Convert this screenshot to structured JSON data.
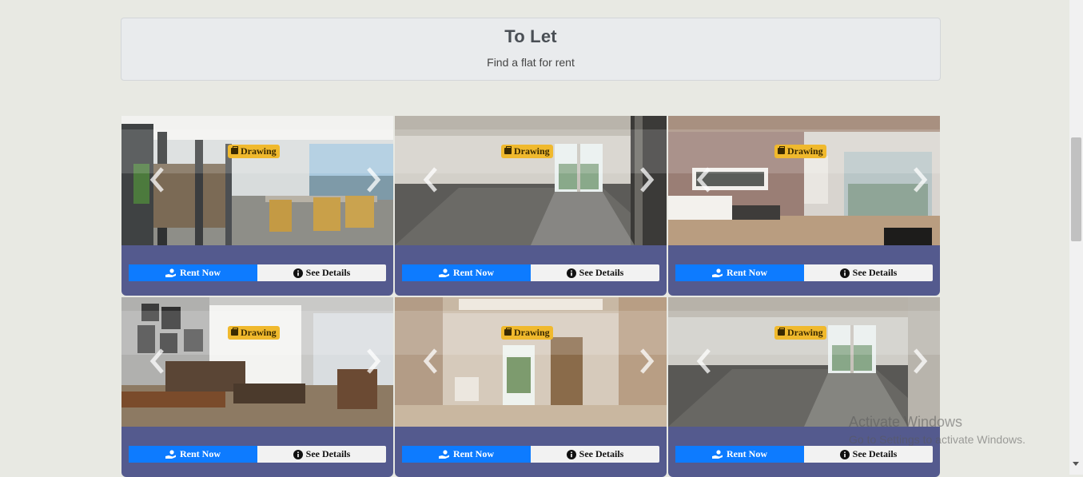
{
  "header": {
    "title": "To Let",
    "subtitle": "Find a flat for rent"
  },
  "colors": {
    "badge": "#f0b92d",
    "rent_button": "#0d7bff",
    "card_footer": "#545a8e"
  },
  "listings": [
    {
      "badge": "Drawing",
      "rent_label": "Rent Now",
      "details_label": "See Details"
    },
    {
      "badge": "Drawing",
      "rent_label": "Rent Now",
      "details_label": "See Details"
    },
    {
      "badge": "Drawing",
      "rent_label": "Rent Now",
      "details_label": "See Details"
    },
    {
      "badge": "Drawing",
      "rent_label": "Rent Now",
      "details_label": "See Details"
    },
    {
      "badge": "Drawing",
      "rent_label": "Rent Now",
      "details_label": "See Details"
    },
    {
      "badge": "Drawing",
      "rent_label": "Rent Now",
      "details_label": "See Details"
    }
  ],
  "icons": {
    "badge": "briefcase-icon",
    "rent": "hand-holding-icon",
    "details": "info-circle-icon",
    "prev": "chevron-left-icon",
    "next": "chevron-right-icon"
  },
  "watermark": {
    "line1": "Activate Windows",
    "line2": "Go to Settings to activate Windows."
  }
}
